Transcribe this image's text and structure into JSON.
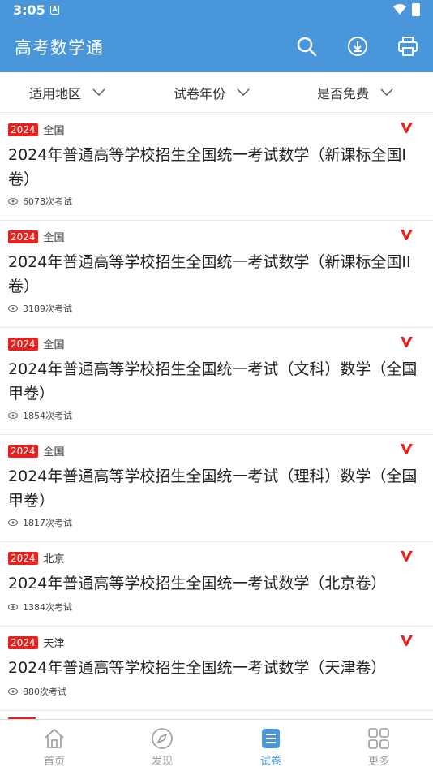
{
  "status_bar": {
    "time": "3:05",
    "notification_icon": "a-icon",
    "wifi_icon": "wifi-icon",
    "battery_icon": "battery-icon"
  },
  "app_bar": {
    "title": "高考数学通",
    "actions": [
      "search-icon",
      "download-icon",
      "print-icon"
    ]
  },
  "filters": [
    {
      "label": "适用地区"
    },
    {
      "label": "试卷年份"
    },
    {
      "label": "是否免费"
    }
  ],
  "exams": [
    {
      "year": "2024",
      "region": "全国",
      "title": "2024年普通高等学校招生全国统一考试数学（新课标全国I卷）",
      "views": "6078次考试"
    },
    {
      "year": "2024",
      "region": "全国",
      "title": "2024年普通高等学校招生全国统一考试数学（新课标全国II卷）",
      "views": "3189次考试"
    },
    {
      "year": "2024",
      "region": "全国",
      "title": "2024年普通高等学校招生全国统一考试（文科）数学（全国甲卷）",
      "views": "1854次考试"
    },
    {
      "year": "2024",
      "region": "全国",
      "title": "2024年普通高等学校招生全国统一考试（理科）数学（全国甲卷）",
      "views": "1817次考试"
    },
    {
      "year": "2024",
      "region": "北京",
      "title": "2024年普通高等学校招生全国统一考试数学（北京卷）",
      "views": "1384次考试"
    },
    {
      "year": "2024",
      "region": "天津",
      "title": "2024年普通高等学校招生全国统一考试数学（天津卷）",
      "views": "880次考试"
    }
  ],
  "bottom_nav": [
    {
      "label": "首页",
      "icon": "home-icon",
      "active": false
    },
    {
      "label": "发现",
      "icon": "compass-icon",
      "active": false
    },
    {
      "label": "试卷",
      "icon": "exam-paper-icon",
      "active": true
    },
    {
      "label": "更多",
      "icon": "grid-icon",
      "active": false
    }
  ],
  "colors": {
    "primary": "#4a96db",
    "badge": "#e8231f",
    "vip": "#e8231f"
  }
}
